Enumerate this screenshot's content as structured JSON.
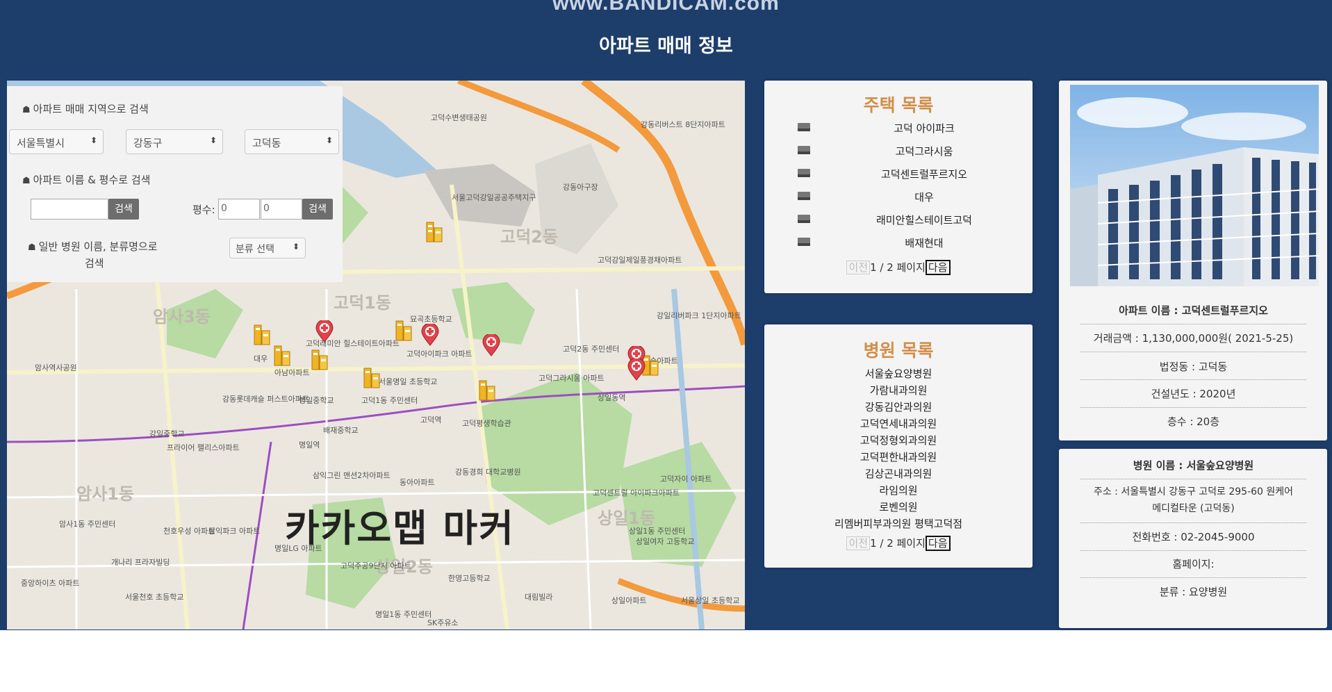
{
  "watermark": "www.BANDICAM.com",
  "title": "아파트 매매 정보",
  "colors": {
    "header": "#1d3e6b",
    "accent": "#d18f4a",
    "card": "#f4f4f4"
  },
  "search": {
    "region_label": "아파트 매매 지역으로 검색",
    "city": "서울특별시",
    "district": "강동구",
    "dong": "고덕동",
    "name_label": "아파트 이름 & 평수로 검색",
    "name_value": "",
    "search_button": "검색",
    "area_label": "평수:",
    "area_min": "0",
    "area_max": "0",
    "area_button": "검색",
    "hospital_label": "일반 병원 이름, 분류명으로",
    "hospital_label2": "검색",
    "category_select": "분류 선택"
  },
  "map": {
    "caption": "카카오맵 마커",
    "dongs": [
      "고덕2동",
      "고덕1동",
      "암사3동",
      "암사1동",
      "상일1동",
      "상일2동"
    ],
    "places": [
      "고덕수변생태공원",
      "강동아구장",
      "서울고덕강일공공주택지구",
      "강동리버스트 8단지아파트",
      "고덕강일제일풍경채아파트",
      "고덕아이파크 아파트",
      "서울명일 초등학교",
      "고덕그라시움 아파트",
      "상일동역",
      "고덕역",
      "명일역",
      "암사역사공원",
      "강일중학교",
      "명일중학교",
      "배재중학교",
      "고덕평생학습관",
      "고덕래미안 힐스테이트아파트",
      "대우",
      "아남아파트",
      "고덕1동 주민센터",
      "고덕2동 주민센터",
      "고덕센트럴 아이파크아파트",
      "고덕자이 아파트",
      "상일1동 주민센터",
      "상일아파트",
      "서울상일 초등학교",
      "한영고등학교",
      "삼익그린 맨션2차아파트",
      "동아아파트",
      "명일LG 아파트",
      "고덕주공9단지 아파트",
      "SK주유소",
      "명일1동 주민센터",
      "프라이어 팰리스아파트",
      "강동롯데캐슬 퍼스트아파트",
      "암사1동 주민센터",
      "천호우성 아파트",
      "삼익파크 아파트",
      "서울천호 초등학교",
      "개나리 프라자빌딩",
      "중앙하이츠 아파트",
      "고덕숲아파트",
      "강일리버파크 1단지아파트",
      "묘곡초등학교",
      "상일여자 고등학교",
      "대림빌라",
      "강동경희 대학교병원"
    ]
  },
  "house_list": {
    "title": "주택 목록",
    "items": [
      "고덕 아이파크",
      "고덕그라시움",
      "고덕센트럴푸르지오",
      "대우",
      "래미안힐스테이트고덕",
      "배재현대"
    ],
    "pager": {
      "prev": "이전",
      "page": "1 / 2 페이지",
      "next": "다음"
    }
  },
  "hospital_list": {
    "title": "병원 목록",
    "items": [
      "서울숲요양병원",
      "가람내과의원",
      "강동김안과의원",
      "고덕연세내과의원",
      "고덕정형외과의원",
      "고덕편한내과의원",
      "김상곤내과의원",
      "라임의원",
      "로벤의원",
      "리멤버피부과의원 평택고덕점"
    ],
    "pager": {
      "prev": "이전",
      "page": "1 / 2 페이지",
      "next": "다음"
    }
  },
  "apartment_detail": {
    "name": "아파트 이름 : 고덕센트럴푸르지오",
    "price": "거래금액 : 1,130,000,000원( 2021-5-25)",
    "dong": "법정동 : 고덕동",
    "year": "건설년도 : 2020년",
    "floor": "층수 : 20층"
  },
  "hospital_detail": {
    "name": "병원 이름 : 서울숲요양병원",
    "address_1": "주소 : 서울특별시 강동구 고덕로 295-60 원케어",
    "address_2": "메디컬타운 (고덕동)",
    "phone": "전화번호 : 02-2045-9000",
    "homepage": "홈페이지:",
    "category": "분류 : 요양병원"
  }
}
